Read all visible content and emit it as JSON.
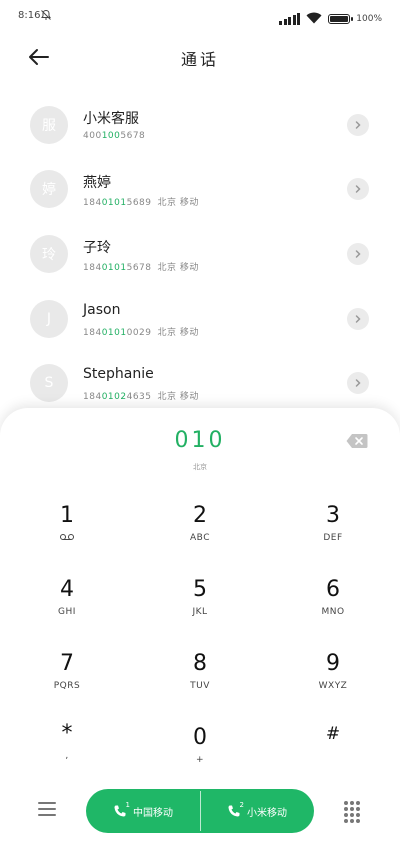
{
  "status_bar": {
    "time": "8:16",
    "battery_text": "100",
    "battery_level": 1.0,
    "bell_icon": "bell-off-icon",
    "wifi_icon": "wifi-icon",
    "signal_icon": "signal-icon"
  },
  "header": {
    "title": "通话",
    "back_icon": "arrow-left-icon"
  },
  "contacts": [
    {
      "avatar": "服",
      "name": "小米客服",
      "number_prefix": "400",
      "number_match": "100",
      "number_suffix": "5678",
      "location": ""
    },
    {
      "avatar": "婷",
      "name": "燕婷",
      "number_prefix": "184",
      "number_match": "0101",
      "number_suffix": "5689",
      "location": "北京 移动"
    },
    {
      "avatar": "玲",
      "name": "子玲",
      "number_prefix": "184",
      "number_match": "0101",
      "number_suffix": "5678",
      "location": "北京 移动"
    },
    {
      "avatar": "J",
      "name": "Jason",
      "number_prefix": "184",
      "number_match": "0101",
      "number_suffix": "0029",
      "location": "北京 移动"
    },
    {
      "avatar": "S",
      "name": "Stephanie",
      "number_prefix": "184",
      "number_match": "0102",
      "number_suffix": "4635",
      "location": "北京 移动"
    }
  ],
  "dialer": {
    "number": "010",
    "location": "北京",
    "keys": [
      {
        "digit": "1",
        "letters": "",
        "icon": "voicemail-icon"
      },
      {
        "digit": "2",
        "letters": "ABC"
      },
      {
        "digit": "3",
        "letters": "DEF"
      },
      {
        "digit": "4",
        "letters": "GHI"
      },
      {
        "digit": "5",
        "letters": "JKL"
      },
      {
        "digit": "6",
        "letters": "MNO"
      },
      {
        "digit": "7",
        "letters": "PQRS"
      },
      {
        "digit": "8",
        "letters": "TUV"
      },
      {
        "digit": "9",
        "letters": "WXYZ"
      },
      {
        "digit": "*",
        "letters": ","
      },
      {
        "digit": "0",
        "letters": "+"
      },
      {
        "digit": "#",
        "letters": ""
      }
    ]
  },
  "bottom_bar": {
    "sim1": {
      "slot": "1",
      "label": "中国移动"
    },
    "sim2": {
      "slot": "2",
      "label": "小米移动"
    }
  },
  "colors": {
    "accent": "#22b063",
    "call_button": "#1fb767"
  }
}
